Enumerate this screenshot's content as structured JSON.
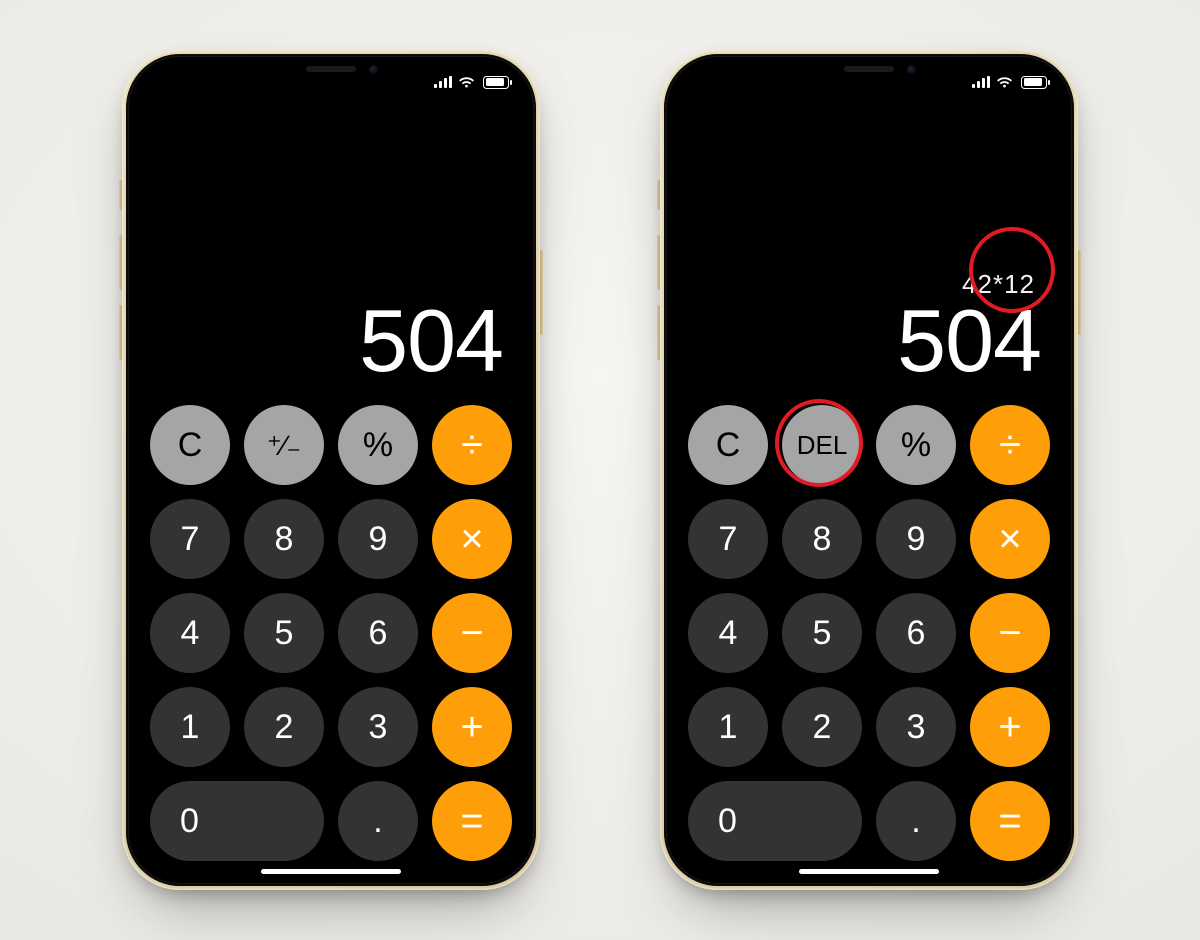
{
  "phones": [
    {
      "formula": "",
      "result": "504",
      "buttons": [
        {
          "name": "clear-button",
          "label": "C",
          "cls": "light",
          "type": "text"
        },
        {
          "name": "plus-minus-button",
          "label": "⁺∕₋",
          "cls": "light",
          "type": "pm"
        },
        {
          "name": "percent-button",
          "label": "%",
          "cls": "light",
          "type": "text"
        },
        {
          "name": "divide-button",
          "label": "÷",
          "cls": "op",
          "type": "text"
        },
        {
          "name": "digit-7",
          "label": "7",
          "cls": "dark",
          "type": "text"
        },
        {
          "name": "digit-8",
          "label": "8",
          "cls": "dark",
          "type": "text"
        },
        {
          "name": "digit-9",
          "label": "9",
          "cls": "dark",
          "type": "text"
        },
        {
          "name": "multiply-button",
          "label": "×",
          "cls": "op",
          "type": "text"
        },
        {
          "name": "digit-4",
          "label": "4",
          "cls": "dark",
          "type": "text"
        },
        {
          "name": "digit-5",
          "label": "5",
          "cls": "dark",
          "type": "text"
        },
        {
          "name": "digit-6",
          "label": "6",
          "cls": "dark",
          "type": "text"
        },
        {
          "name": "minus-button",
          "label": "−",
          "cls": "op",
          "type": "text"
        },
        {
          "name": "digit-1",
          "label": "1",
          "cls": "dark",
          "type": "text"
        },
        {
          "name": "digit-2",
          "label": "2",
          "cls": "dark",
          "type": "text"
        },
        {
          "name": "digit-3",
          "label": "3",
          "cls": "dark",
          "type": "text"
        },
        {
          "name": "plus-button",
          "label": "+",
          "cls": "op",
          "type": "text"
        },
        {
          "name": "digit-0",
          "label": "0",
          "cls": "dark wide",
          "type": "text"
        },
        {
          "name": "decimal-button",
          "label": ".",
          "cls": "dark",
          "type": "text"
        },
        {
          "name": "equals-button",
          "label": "=",
          "cls": "op",
          "type": "text"
        }
      ],
      "annotations": []
    },
    {
      "formula": "42*12",
      "result": "504",
      "buttons": [
        {
          "name": "clear-button",
          "label": "C",
          "cls": "light",
          "type": "text"
        },
        {
          "name": "delete-button",
          "label": "DEL",
          "cls": "light",
          "type": "del"
        },
        {
          "name": "percent-button",
          "label": "%",
          "cls": "light",
          "type": "text"
        },
        {
          "name": "divide-button",
          "label": "÷",
          "cls": "op",
          "type": "text"
        },
        {
          "name": "digit-7",
          "label": "7",
          "cls": "dark",
          "type": "text"
        },
        {
          "name": "digit-8",
          "label": "8",
          "cls": "dark",
          "type": "text"
        },
        {
          "name": "digit-9",
          "label": "9",
          "cls": "dark",
          "type": "text"
        },
        {
          "name": "multiply-button",
          "label": "×",
          "cls": "op",
          "type": "text"
        },
        {
          "name": "digit-4",
          "label": "4",
          "cls": "dark",
          "type": "text"
        },
        {
          "name": "digit-5",
          "label": "5",
          "cls": "dark",
          "type": "text"
        },
        {
          "name": "digit-6",
          "label": "6",
          "cls": "dark",
          "type": "text"
        },
        {
          "name": "minus-button",
          "label": "−",
          "cls": "op",
          "type": "text"
        },
        {
          "name": "digit-1",
          "label": "1",
          "cls": "dark",
          "type": "text"
        },
        {
          "name": "digit-2",
          "label": "2",
          "cls": "dark",
          "type": "text"
        },
        {
          "name": "digit-3",
          "label": "3",
          "cls": "dark",
          "type": "text"
        },
        {
          "name": "plus-button",
          "label": "+",
          "cls": "op",
          "type": "text"
        },
        {
          "name": "digit-0",
          "label": "0",
          "cls": "dark wide",
          "type": "text"
        },
        {
          "name": "decimal-button",
          "label": ".",
          "cls": "dark",
          "type": "text"
        },
        {
          "name": "equals-button",
          "label": "=",
          "cls": "op",
          "type": "text"
        }
      ],
      "annotations": [
        {
          "name": "formula-highlight",
          "style": "top:170px;right:16px;width:86px;height:86px;"
        },
        {
          "name": "delete-highlight",
          "style": "top:342px;left:108px;width:88px;height:88px;"
        }
      ]
    }
  ]
}
